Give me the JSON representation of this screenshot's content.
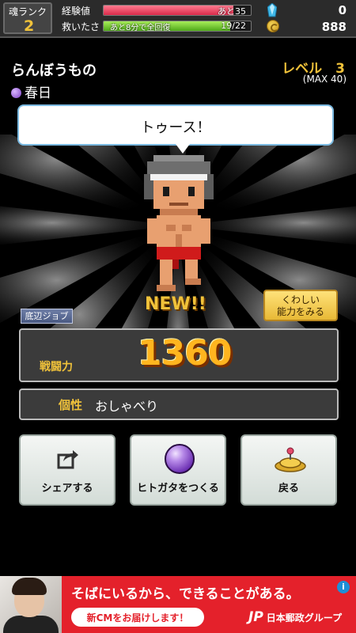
{
  "status": {
    "rank_label": "魂ランク",
    "rank_value": "2",
    "exp_label": "経験値",
    "exp_text": "あと35",
    "exp_progress": 0.88,
    "stamina_label": "救いたさ",
    "stamina_sub": "あと8分で全回復",
    "stamina_text": "19/22",
    "stamina_progress": 0.86,
    "gems": "0",
    "coins": "888"
  },
  "character": {
    "name": "らんぼうもの",
    "attribute": "春日",
    "level_text": "レベル　3",
    "level_max": "(MAX 40)",
    "speech": "トゥース！",
    "new_badge": "NEW!!",
    "detail_button_line1": "くわしい",
    "detail_button_line2": "能力をみる",
    "job_tag": "底辺ジョブ",
    "power_label": "戦闘力",
    "power_value": "1360",
    "trait_label": "個性",
    "trait_value": "おしゃべり"
  },
  "actions": {
    "share": "シェアする",
    "create": "ヒトガタをつくる",
    "back": "戻る"
  },
  "ad": {
    "headline": "そばにいるから、できることがある。",
    "sub": "新CMをお届けします！",
    "logo_mark": "JP",
    "logo_text": "日本郵政グループ",
    "info": "i"
  },
  "colors": {
    "accent_gold": "#f0c23a",
    "exp_bar": "#e23d5a",
    "stamina_bar": "#6fcf2a",
    "ad_red": "#e4212b"
  }
}
